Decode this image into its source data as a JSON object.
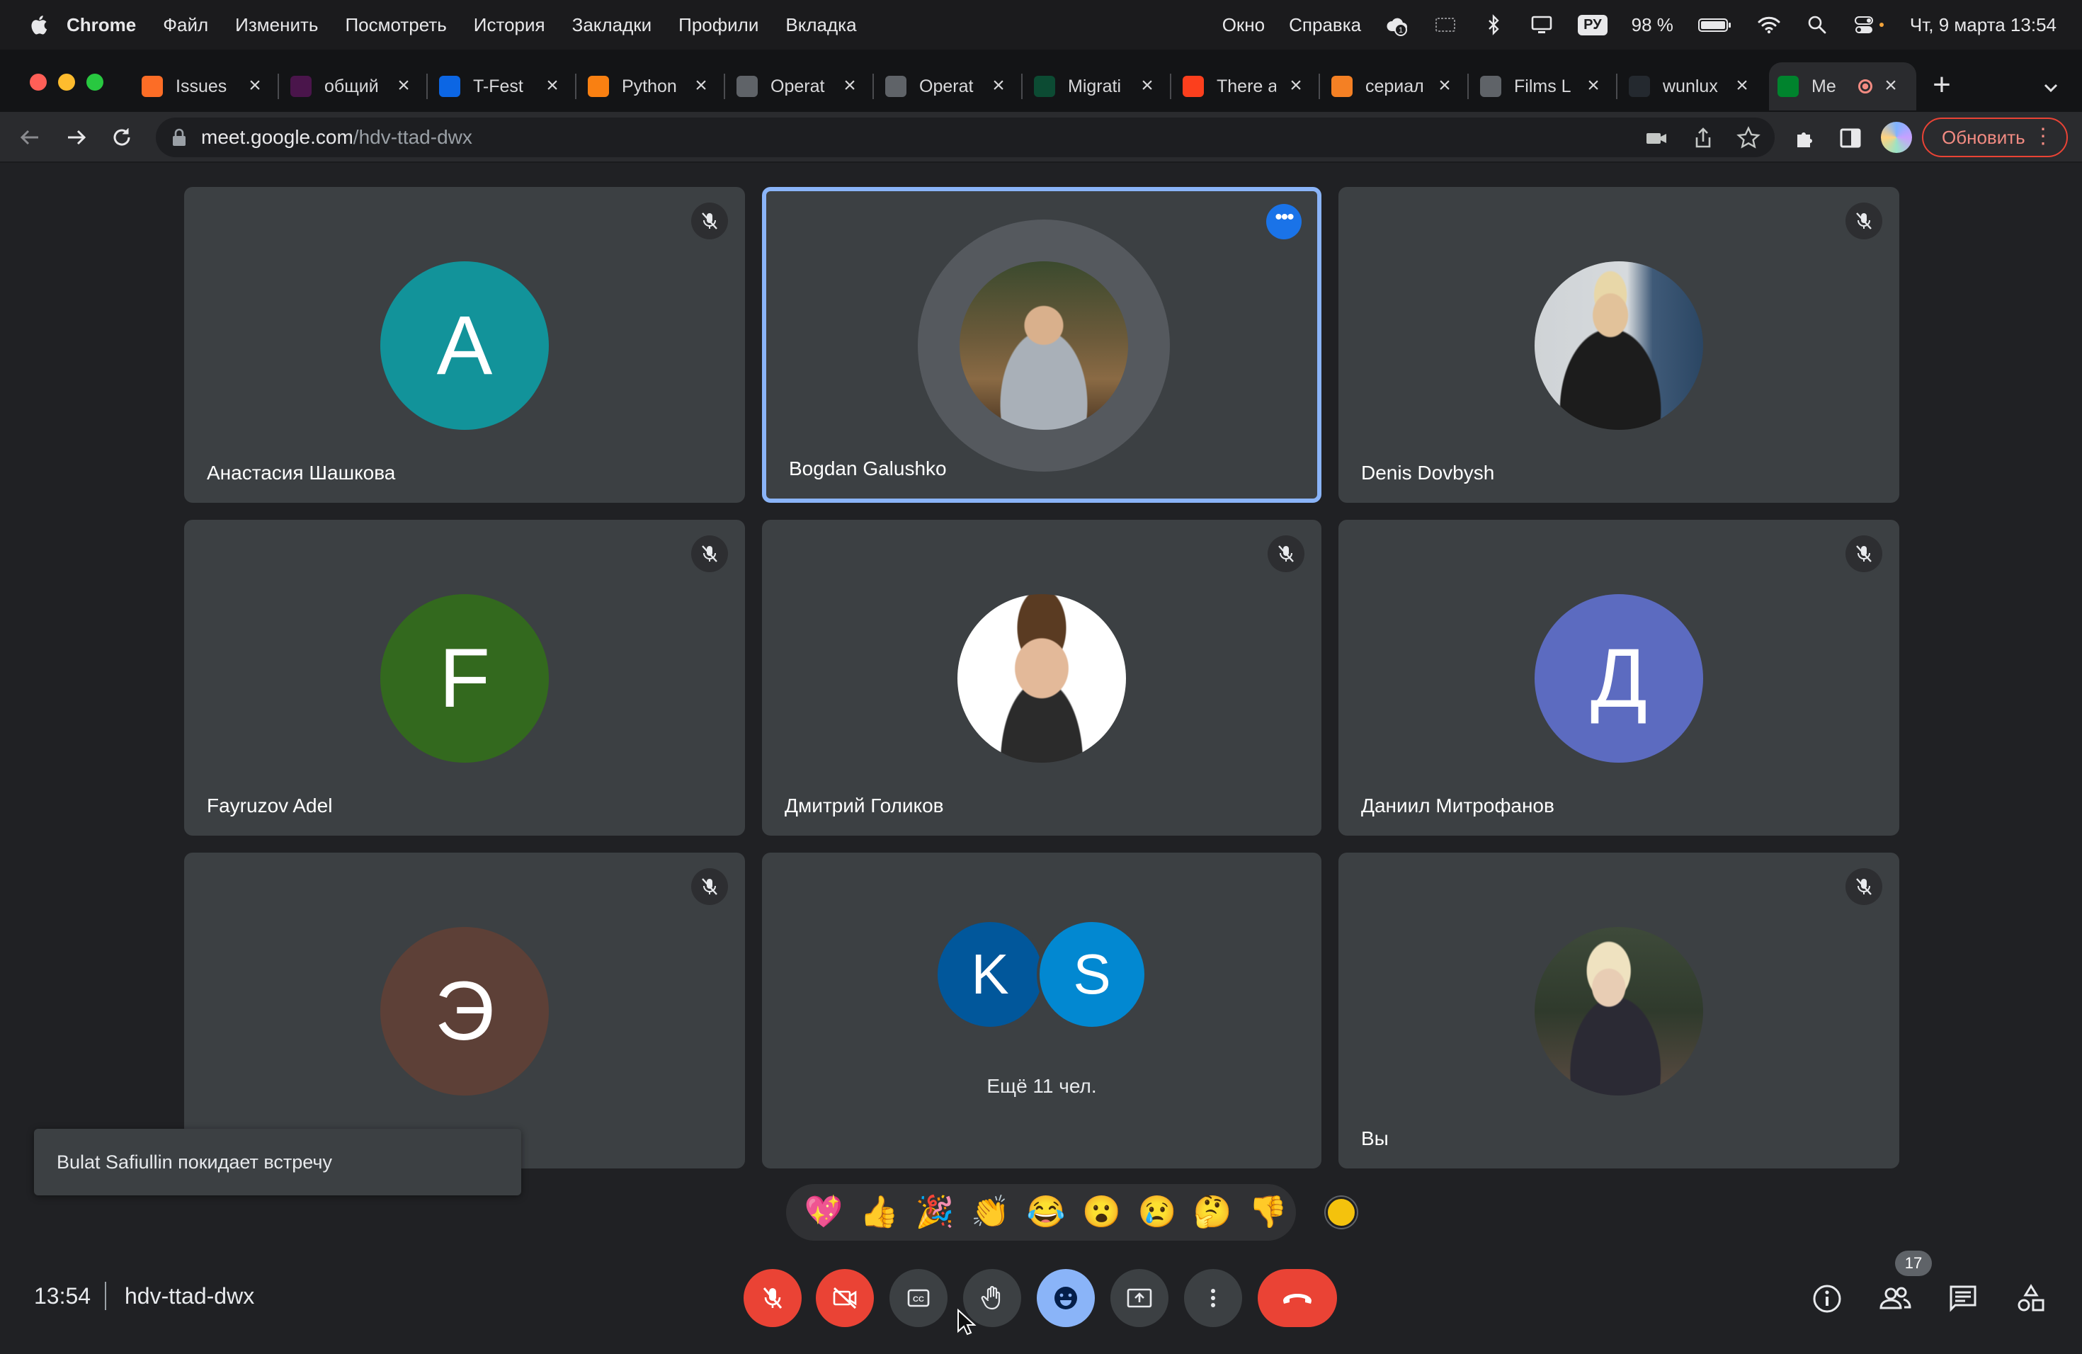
{
  "menubar": {
    "app_name": "Chrome",
    "menu_items": [
      "Файл",
      "Изменить",
      "Посмотреть",
      "История",
      "Закладки",
      "Профили",
      "Вкладка"
    ],
    "right_items": [
      "Окно",
      "Справка"
    ],
    "input_lang": "РУ",
    "battery": "98 %",
    "datetime": "Чт, 9 марта  13:54"
  },
  "tabs": [
    {
      "label": "Issues",
      "icon": "gitlab-icon",
      "color": "#fc6d26"
    },
    {
      "label": "общий",
      "icon": "slack-icon",
      "color": "#4a154b"
    },
    {
      "label": "T-Fest",
      "icon": "trello-icon",
      "color": "#0c66e4"
    },
    {
      "label": "Python",
      "icon": "moodle-icon",
      "color": "#f98012"
    },
    {
      "label": "Operat",
      "icon": "globe-icon",
      "color": "#5f6368"
    },
    {
      "label": "Operat",
      "icon": "globe-icon",
      "color": "#5f6368"
    },
    {
      "label": "Migrati",
      "icon": "django-icon",
      "color": "#0c4b33"
    },
    {
      "label": "There a",
      "icon": "yandex-icon",
      "color": "#fc3f1d"
    },
    {
      "label": "сериал",
      "icon": "stackoverflow-icon",
      "color": "#f48024"
    },
    {
      "label": "Films L",
      "icon": "globe-icon",
      "color": "#5f6368"
    },
    {
      "label": "wunlux",
      "icon": "github-icon",
      "color": "#24292f"
    },
    {
      "label": "Me",
      "icon": "google-meet-icon",
      "color": "#00832d"
    }
  ],
  "address": {
    "host": "meet.google.com",
    "path": "/hdv-ttad-dwx",
    "update_label": "Обновить"
  },
  "participants": [
    {
      "name": "Анастасия Шашкова",
      "initial": "А",
      "color": "#12939a"
    },
    {
      "name": "Bogdan Galushko",
      "photo": true,
      "speaking": true
    },
    {
      "name": "Denis Dovbysh",
      "photo": true
    },
    {
      "name": "Fayruzov Adel",
      "initial": "F",
      "color": "#33691e"
    },
    {
      "name": "Дмитрий Голиков",
      "photo": true
    },
    {
      "name": "Даниил Митрофанов",
      "initial": "Д",
      "color": "#5c6bc0"
    },
    {
      "name": "",
      "initial": "Э",
      "color": "#5d4037"
    },
    {
      "name": "Вы",
      "photo": true
    }
  ],
  "more_people": {
    "avatars": [
      {
        "initial": "K",
        "color": "#01579b"
      },
      {
        "initial": "S",
        "color": "#0288d1"
      }
    ],
    "label": "Ещё 11 чел."
  },
  "toast": "Bulat Safiullin покидает встречу",
  "reactions": [
    "💖",
    "👍",
    "🎉",
    "👏",
    "😂",
    "😮",
    "😢",
    "🤔",
    "👎"
  ],
  "meeting": {
    "time": "13:54",
    "code": "hdv-ttad-dwx",
    "people_count": "17"
  },
  "colors": {
    "background": "#202124",
    "tile": "#3c4043",
    "accent": "#8ab4f8",
    "danger": "#ea4335"
  }
}
